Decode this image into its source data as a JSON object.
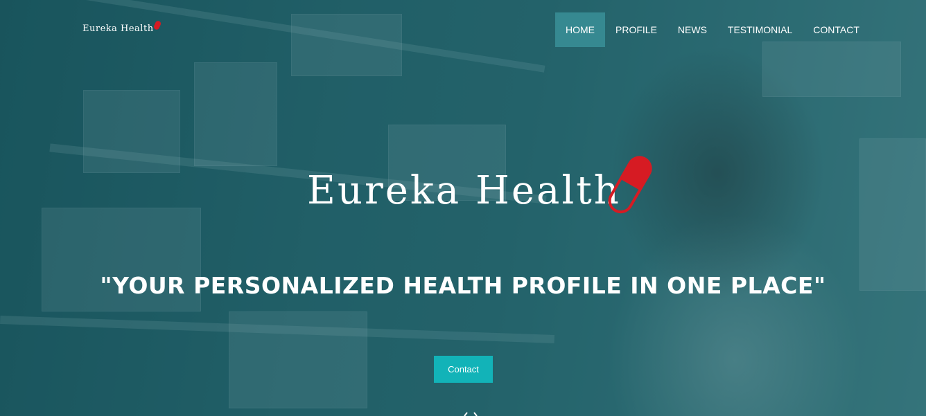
{
  "header": {
    "logo_text": "Eureka Health",
    "nav": [
      {
        "label": "HOME",
        "active": true
      },
      {
        "label": "PROFILE",
        "active": false
      },
      {
        "label": "NEWS",
        "active": false
      },
      {
        "label": "TESTIMONIAL",
        "active": false
      },
      {
        "label": "CONTACT",
        "active": false
      }
    ]
  },
  "hero": {
    "brand_title": "Eureka Health",
    "tagline": "\"YOUR PERSONALIZED HEALTH PROFILE IN ONE PLACE\"",
    "cta_label": "Contact",
    "scroll_icon": "chevron-down-icon"
  },
  "colors": {
    "overlay_teal": "#1d4f57",
    "accent_button": "#12b3b8",
    "nav_active_bg": "#3c969e",
    "capsule_red": "#d61b23"
  }
}
